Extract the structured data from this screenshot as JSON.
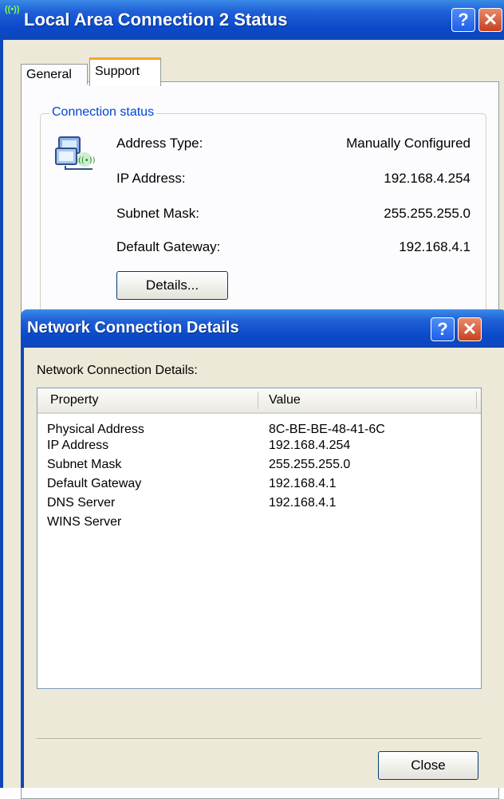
{
  "status_window": {
    "title": "Local Area Connection 2 Status",
    "tabs": [
      {
        "label": "General"
      },
      {
        "label": "Support"
      }
    ],
    "active_tab": "Support",
    "group_title": "Connection status",
    "rows": [
      {
        "label": "Address Type:",
        "value": "Manually Configured"
      },
      {
        "label": "IP Address:",
        "value": "192.168.4.254"
      },
      {
        "label": "Subnet Mask:",
        "value": "255.255.255.0"
      },
      {
        "label": "Default Gateway:",
        "value": "192.168.4.1"
      }
    ],
    "details_button": "Details...",
    "help_glyph": "?",
    "close_glyph": "✕",
    "icons": {
      "title": "wireless-signal-icon",
      "status": "network-connection-icon"
    }
  },
  "details_dialog": {
    "title": "Network Connection Details",
    "label": "Network Connection Details:",
    "columns": [
      "Property",
      "Value"
    ],
    "rows": [
      {
        "property": "Physical Address",
        "value": "8C-BE-BE-48-41-6C"
      },
      {
        "property": "IP Address",
        "value": "192.168.4.254"
      },
      {
        "property": "Subnet Mask",
        "value": "255.255.255.0"
      },
      {
        "property": "Default Gateway",
        "value": "192.168.4.1"
      },
      {
        "property": "DNS Server",
        "value": "192.168.4.1"
      },
      {
        "property": "WINS Server",
        "value": ""
      }
    ],
    "close_button": "Close",
    "help_glyph": "?",
    "close_glyph": "✕"
  },
  "colors": {
    "titlebar_blue": "#0a49c9",
    "dialog_face": "#ece9d8",
    "group_title_blue": "#0046d5",
    "active_tab_accent": "#f5a623",
    "close_button_red": "#c8401f"
  }
}
